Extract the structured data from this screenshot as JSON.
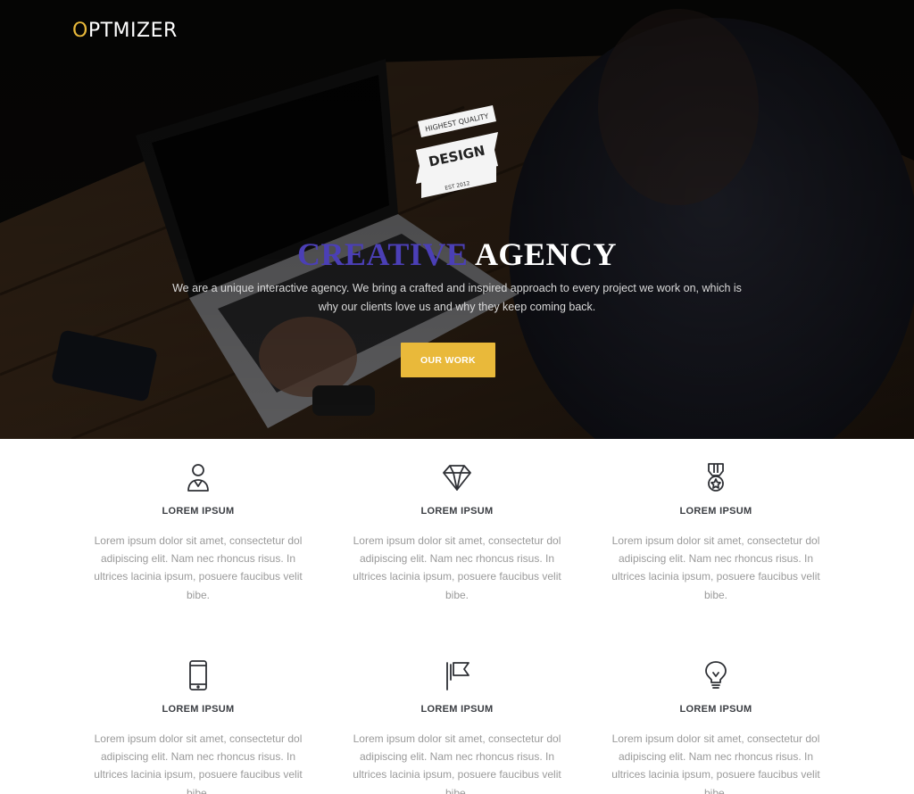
{
  "brand": {
    "logo_first": "O",
    "logo_rest": "PTMIZER",
    "accent": "#e9b93a"
  },
  "badge": {
    "top_text": "HIGHEST QUALITY",
    "main_text": "DESIGN",
    "bottom_text": "EST 2012"
  },
  "hero": {
    "headline_left": "CREATIVE",
    "headline_right": "AGENCY",
    "headline_left_color": "#4b3fb6",
    "description": "We are a unique interactive agency. We bring a crafted and inspired approach to every project we work on, which is why our clients love us and why they keep coming back.",
    "cta_label": "OUR WORK"
  },
  "features": [
    {
      "icon": "user-icon",
      "title": "LOREM IPSUM",
      "text": "Lorem ipsum dolor sit amet, consectetur dol adipiscing elit. Nam nec rhoncus risus. In ultrices lacinia ipsum, posuere faucibus velit bibe."
    },
    {
      "icon": "diamond-icon",
      "title": "LOREM IPSUM",
      "text": "Lorem ipsum dolor sit amet, consectetur dol adipiscing elit. Nam nec rhoncus risus. In ultrices lacinia ipsum, posuere faucibus velit bibe."
    },
    {
      "icon": "medal-icon",
      "title": "LOREM IPSUM",
      "text": "Lorem ipsum dolor sit amet, consectetur dol adipiscing elit. Nam nec rhoncus risus. In ultrices lacinia ipsum, posuere faucibus velit bibe."
    },
    {
      "icon": "smartphone-icon",
      "title": "LOREM IPSUM",
      "text": "Lorem ipsum dolor sit amet, consectetur dol adipiscing elit. Nam nec rhoncus risus. In ultrices lacinia ipsum, posuere faucibus velit bibe."
    },
    {
      "icon": "flag-icon",
      "title": "LOREM IPSUM",
      "text": "Lorem ipsum dolor sit amet, consectetur dol adipiscing elit. Nam nec rhoncus risus. In ultrices lacinia ipsum, posuere faucibus velit bibe."
    },
    {
      "icon": "lightbulb-icon",
      "title": "LOREM IPSUM",
      "text": "Lorem ipsum dolor sit amet, consectetur dol adipiscing elit. Nam nec rhoncus risus. In ultrices lacinia ipsum, posuere faucibus velit bibe."
    }
  ]
}
